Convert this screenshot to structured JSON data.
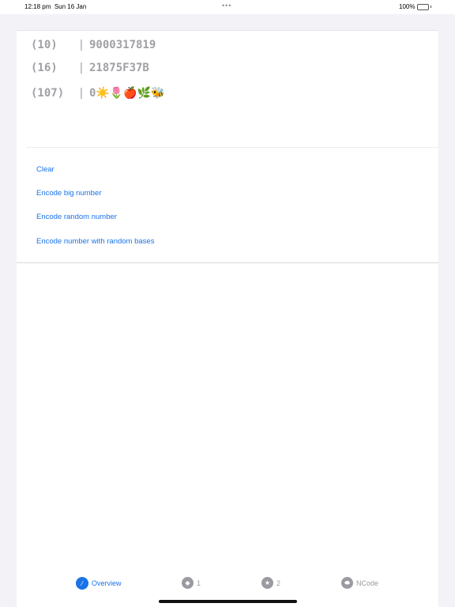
{
  "status_bar": {
    "time": "12:18 pm",
    "date": "Sun 16 Jan",
    "dots": "•••",
    "battery_percent": "100%",
    "battery_level": 1.0,
    "battery_color": "#34c759"
  },
  "encodings": [
    {
      "base": "(10)",
      "separator": "|",
      "value": "9000317819"
    },
    {
      "base": "(16)",
      "separator": "|",
      "value": "21875F37B"
    },
    {
      "base": "(107)",
      "separator": "|",
      "value": "0☀️🌷🍎🌿🐝"
    }
  ],
  "actions": [
    {
      "label": "Clear"
    },
    {
      "label": "Encode big number"
    },
    {
      "label": "Encode random number"
    },
    {
      "label": "Encode number with random bases"
    }
  ],
  "tabs": [
    {
      "label": "Overview",
      "icon": "compass-icon",
      "glyph": "⁄",
      "active": true
    },
    {
      "label": "1",
      "icon": "diamond-icon",
      "glyph": "◆",
      "active": false
    },
    {
      "label": "2",
      "icon": "star-icon",
      "glyph": "★",
      "active": false
    },
    {
      "label": "NCode",
      "icon": "tag-icon",
      "glyph": "⬬",
      "active": false
    }
  ],
  "colors": {
    "accent": "#1a73e8",
    "inactive": "#9a9aa0",
    "background": "#f2f2f7"
  }
}
